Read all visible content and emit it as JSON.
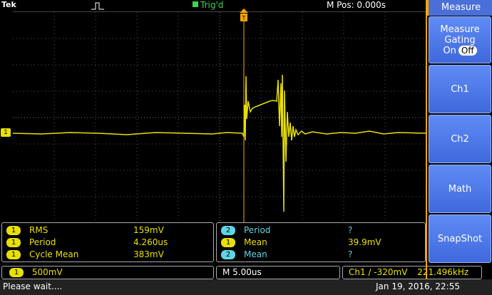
{
  "topbar": {
    "brand": "Tek",
    "trigger_status": "Trig'd",
    "m_pos": "M Pos: 0.000s"
  },
  "channel_marker": "1",
  "side_menu": {
    "title": "Measure",
    "gating_line1": "Measure",
    "gating_line2": "Gating",
    "gating_on": "On",
    "gating_off": "Off",
    "ch1": "Ch1",
    "ch2": "Ch2",
    "math": "Math",
    "snapshot": "SnapShot"
  },
  "measurements_left": [
    {
      "ch": "1",
      "label": "RMS",
      "value": "159mV"
    },
    {
      "ch": "1",
      "label": "Period",
      "value": "4.260us"
    },
    {
      "ch": "1",
      "label": "Cycle Mean",
      "value": "383mV"
    }
  ],
  "measurements_right": [
    {
      "ch": "2",
      "label": "Period",
      "value": "?"
    },
    {
      "ch": "1",
      "label": "Mean",
      "value": "39.9mV"
    },
    {
      "ch": "2",
      "label": "Mean",
      "value": "?"
    }
  ],
  "status": {
    "ch1_scale_badge": "1",
    "ch1_scale": "500mV",
    "timebase": "M 5.00us",
    "trigger": "Ch1 ∕ -320mV",
    "frequency": "221.496kHz",
    "message": "Please wait....",
    "datetime": "Jan 19, 2016, 22:55"
  }
}
